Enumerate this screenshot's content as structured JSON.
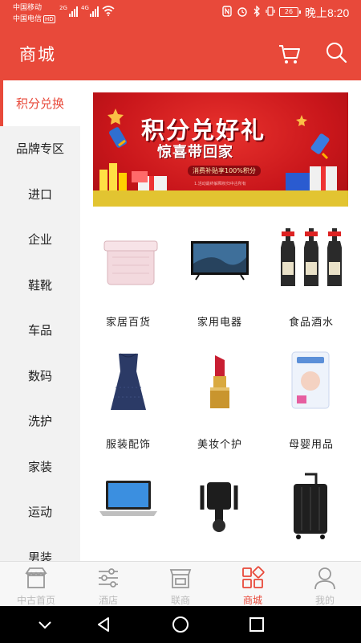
{
  "status_bar": {
    "carrier1": "中国移动",
    "carrier2": "中国电信",
    "hd": "HD",
    "net1": "2G",
    "net2": "4G",
    "battery": "26",
    "time": "晚上8:20"
  },
  "header": {
    "title": "商城",
    "cart_icon": "cart-icon",
    "search_icon": "search-icon"
  },
  "sidebar": {
    "items": [
      {
        "label": "积分兑换",
        "active": true
      },
      {
        "label": "品牌专区"
      },
      {
        "label": "进口"
      },
      {
        "label": "企业"
      },
      {
        "label": "鞋靴"
      },
      {
        "label": "车品"
      },
      {
        "label": "数码"
      },
      {
        "label": "洗护"
      },
      {
        "label": "家装"
      },
      {
        "label": "运动"
      },
      {
        "label": "男装"
      }
    ]
  },
  "banner": {
    "title": "积分兑好礼",
    "subtitle": "惊喜带回家",
    "note": "消费补贴享100%积分",
    "fine_print": "1.活动最终解释权归中古所有"
  },
  "products": [
    {
      "label": "家居百货",
      "icon": "storage-box-icon"
    },
    {
      "label": "家用电器",
      "icon": "television-icon"
    },
    {
      "label": "食品酒水",
      "icon": "wine-bottles-icon"
    },
    {
      "label": "服装配饰",
      "icon": "dress-icon"
    },
    {
      "label": "美妆个护",
      "icon": "lipstick-icon"
    },
    {
      "label": "母婴用品",
      "icon": "diapers-icon"
    },
    {
      "label": "",
      "icon": "laptop-icon"
    },
    {
      "label": "",
      "icon": "phone-holder-icon"
    },
    {
      "label": "",
      "icon": "luggage-icon"
    }
  ],
  "bottom_nav": [
    {
      "label": "中古首页",
      "icon": "shop-icon"
    },
    {
      "label": "酒店",
      "icon": "sliders-icon"
    },
    {
      "label": "联商",
      "icon": "store-icon"
    },
    {
      "label": "商城",
      "icon": "grid-icon",
      "active": true
    },
    {
      "label": "我的",
      "icon": "person-icon"
    }
  ],
  "colors": {
    "accent": "#e8493a",
    "sidebar_bg": "#f2f2f2",
    "inactive": "#bbbbbb"
  }
}
